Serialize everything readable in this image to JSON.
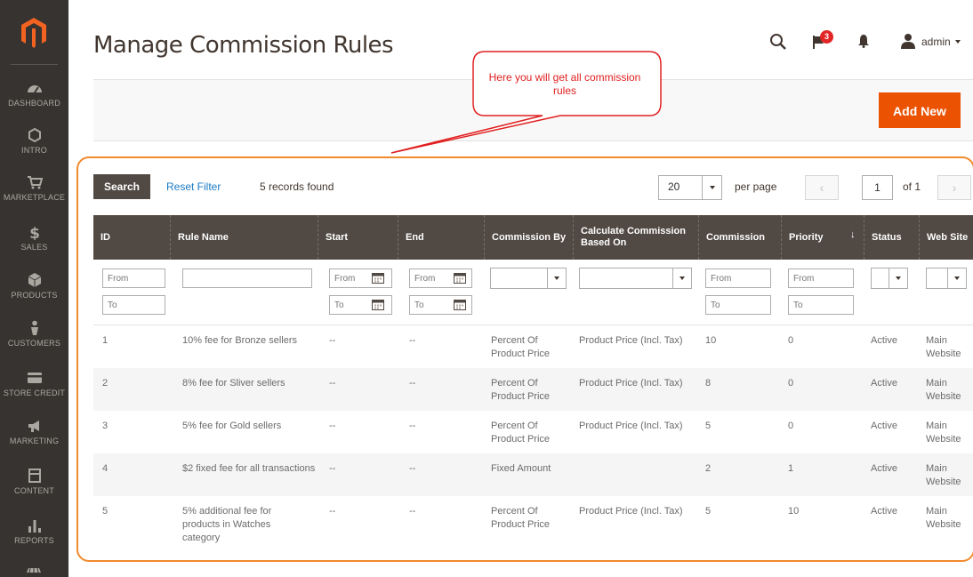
{
  "nav": [
    {
      "label": "DASHBOARD",
      "icon": "dashboard-icon"
    },
    {
      "label": "INTRO",
      "icon": "hexagon-icon"
    },
    {
      "label": "MARKETPLACE",
      "icon": "cart-icon"
    },
    {
      "label": "SALES",
      "icon": "dollar-icon"
    },
    {
      "label": "PRODUCTS",
      "icon": "box-icon"
    },
    {
      "label": "CUSTOMERS",
      "icon": "person-icon"
    },
    {
      "label": "STORE CREDIT",
      "icon": "card-icon"
    },
    {
      "label": "MARKETING",
      "icon": "megaphone-icon"
    },
    {
      "label": "CONTENT",
      "icon": "content-icon"
    },
    {
      "label": "REPORTS",
      "icon": "bar-chart-icon"
    }
  ],
  "header": {
    "title": "Manage Commission Rules",
    "notifications_count": "3",
    "username": "admin"
  },
  "callout": {
    "text": "Here you will get all commission rules"
  },
  "actions": {
    "add_new": "Add New"
  },
  "toolbar": {
    "search": "Search",
    "reset_filter": "Reset Filter",
    "records": "5 records found",
    "per_page_value": "20",
    "per_page_label": "per page",
    "page": "1",
    "of": "of 1"
  },
  "columns": [
    "ID",
    "Rule Name",
    "Start",
    "End",
    "Commission By",
    "Calculate Commission Based On",
    "Commission",
    "Priority",
    "Status",
    "Web Site"
  ],
  "filters": {
    "from": "From",
    "to": "To"
  },
  "rows": [
    {
      "id": "1",
      "name": "10% fee for Bronze sellers",
      "start": "--",
      "end": "--",
      "by": "Percent Of Product Price",
      "based": "Product Price (Incl. Tax)",
      "commission": "10",
      "priority": "0",
      "status": "Active",
      "website": "Main Website"
    },
    {
      "id": "2",
      "name": "8% fee for Sliver sellers",
      "start": "--",
      "end": "--",
      "by": "Percent Of Product Price",
      "based": "Product Price (Incl. Tax)",
      "commission": "8",
      "priority": "0",
      "status": "Active",
      "website": "Main Website"
    },
    {
      "id": "3",
      "name": "5% fee for Gold sellers",
      "start": "--",
      "end": "--",
      "by": "Percent Of Product Price",
      "based": "Product Price (Incl. Tax)",
      "commission": "5",
      "priority": "0",
      "status": "Active",
      "website": "Main Website"
    },
    {
      "id": "4",
      "name": "$2 fixed fee for all transactions",
      "start": "--",
      "end": "--",
      "by": "Fixed Amount",
      "based": "",
      "commission": "2",
      "priority": "1",
      "status": "Active",
      "website": "Main Website"
    },
    {
      "id": "5",
      "name": "5% additional fee for products in Watches category",
      "start": "--",
      "end": "--",
      "by": "Percent Of Product Price",
      "based": "Product Price (Incl. Tax)",
      "commission": "5",
      "priority": "10",
      "status": "Active",
      "website": "Main Website"
    }
  ],
  "colors": {
    "accent": "#eb5202",
    "sidebar": "#373330",
    "table_header": "#514943",
    "link": "#1979c3",
    "highlight": "#f08a2c",
    "callout": "#e02020"
  }
}
